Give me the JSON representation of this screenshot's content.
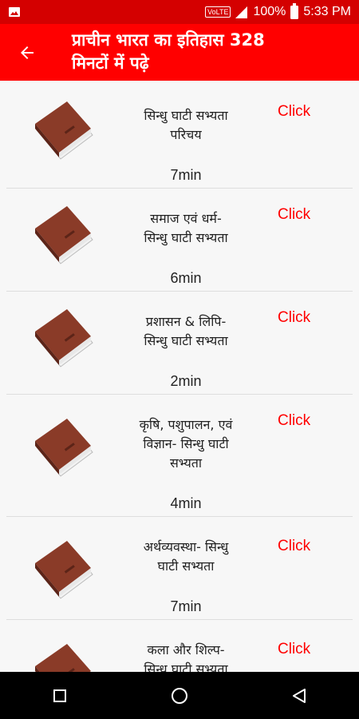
{
  "status": {
    "volte": "VoLTE",
    "battery_pct": "100%",
    "time": "5:33 PM"
  },
  "app": {
    "title_line1": "प्राचीन भारत का इतिहास 328",
    "title_line2": "मिनटों में पढ़े"
  },
  "items": [
    {
      "line1": "सिन्धु घाटी सभ्यता",
      "line2": "परिचय",
      "line3": "",
      "action": "Click",
      "duration": "7min"
    },
    {
      "line1": "समाज एवं धर्म-",
      "line2": "सिन्धु घाटी सभ्यता",
      "line3": "",
      "action": "Click",
      "duration": "6min"
    },
    {
      "line1": "प्रशासन & लिपि-",
      "line2": "सिन्धु घाटी सभ्यता",
      "line3": "",
      "action": "Click",
      "duration": "2min"
    },
    {
      "line1": "कृषि, पशुपालन, एवं",
      "line2": "विज्ञान- सिन्धु घाटी",
      "line3": "सभ्यता",
      "action": "Click",
      "duration": "4min"
    },
    {
      "line1": "अर्थव्यवस्था- सिन्धु",
      "line2": "घाटी सभ्यता",
      "line3": "",
      "action": "Click",
      "duration": "7min"
    },
    {
      "line1": "कला और शिल्प-",
      "line2": "सिन्धु घाटी सभ्यता",
      "line3": "",
      "action": "Click",
      "duration": ""
    }
  ],
  "icons": {
    "back": "arrow-back-icon",
    "thumb": "book-icon",
    "nav_recent": "square-icon",
    "nav_home": "circle-icon",
    "nav_back": "triangle-icon"
  }
}
